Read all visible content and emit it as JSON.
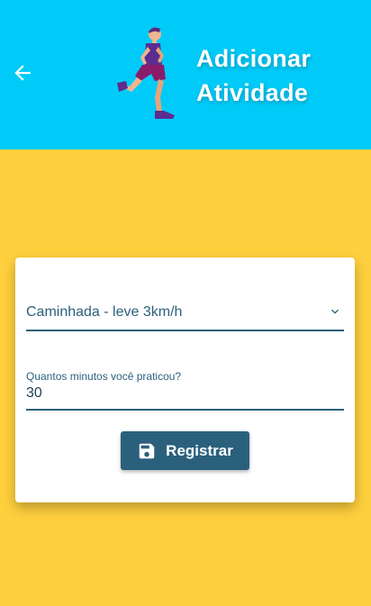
{
  "header": {
    "title_line1": "Adicionar",
    "title_line2": "Atividade",
    "background": "#00cbf8",
    "back_icon": "arrow-left-icon",
    "illustration": "runner-illustration"
  },
  "page": {
    "background": "#ffd03d"
  },
  "form": {
    "activity_select": {
      "value": "Caminhada - leve 3km/h",
      "icon": "chevron-down-icon"
    },
    "minutes_field": {
      "label": "Quantos minutos você praticou?",
      "value": "30"
    },
    "submit": {
      "label": "Registrar",
      "icon": "save-icon",
      "color": "#2b607d"
    }
  }
}
